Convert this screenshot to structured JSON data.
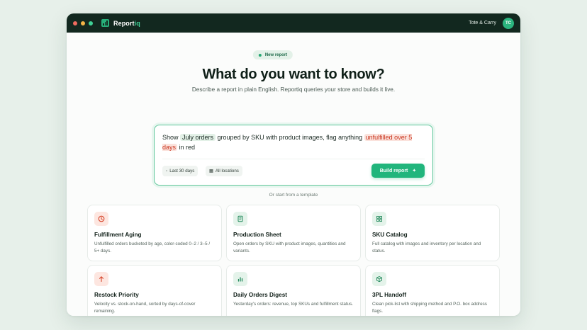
{
  "window": {
    "dots": [
      "#ee6b5f",
      "#f3b447",
      "#3fd196"
    ],
    "brand": {
      "name_main": "Report",
      "name_accent": "iq"
    },
    "store_name": "Tote & Carry",
    "avatar_initials": "TC"
  },
  "hero": {
    "pill": "New report",
    "title": "What do you want to know?",
    "subtitle": "Describe a report in plain English. Reportiq queries your store and builds it live."
  },
  "prompt": {
    "seg1": "Show ",
    "token1": "July orders",
    "seg2": " grouped by SKU with product images, flag anything ",
    "flag1": "unfulfilled over 5 days",
    "seg3": " in red",
    "filters": [
      {
        "icon": "clock-icon",
        "glyph": "◦",
        "label": "Last 30 days"
      },
      {
        "icon": "grid-icon",
        "glyph": "▦",
        "label": "All locations"
      }
    ],
    "build_label": "Build report",
    "build_glyph": "✦"
  },
  "templates": {
    "heading": "Or start from a template",
    "cards": [
      {
        "title": "Fulfillment Aging",
        "desc": "Unfulfilled orders bucketed by age, color-coded 0–2 / 3–5 / 5+ days.",
        "icon": "clock-icon",
        "tone": "red"
      },
      {
        "title": "Production Sheet",
        "desc": "Open orders by SKU with product images, quantities and variants.",
        "icon": "document-icon",
        "tone": "green"
      },
      {
        "title": "SKU Catalog",
        "desc": "Full catalog with images and inventory per location and status.",
        "icon": "grid-icon",
        "tone": "green"
      },
      {
        "title": "Restock Priority",
        "desc": "Velocity vs. stock-on-hand, sorted by days-of-cover remaining.",
        "icon": "arrow-up-icon",
        "tone": "red"
      },
      {
        "title": "Daily Orders Digest",
        "desc": "Yesterday's orders: revenue, top SKUs and fulfillment status.",
        "icon": "bar-chart-icon",
        "tone": "green"
      },
      {
        "title": "3PL Handoff",
        "desc": "Clean pick-list with shipping method and P.O. box address flags.",
        "icon": "box-icon",
        "tone": "green"
      }
    ]
  },
  "colors": {
    "accent": "#21b57c",
    "titlebar": "#12281f",
    "red_tint": "#fde6e0",
    "red": "#d6452b",
    "green_tint": "#e4f3ea",
    "green": "#238a5c"
  }
}
